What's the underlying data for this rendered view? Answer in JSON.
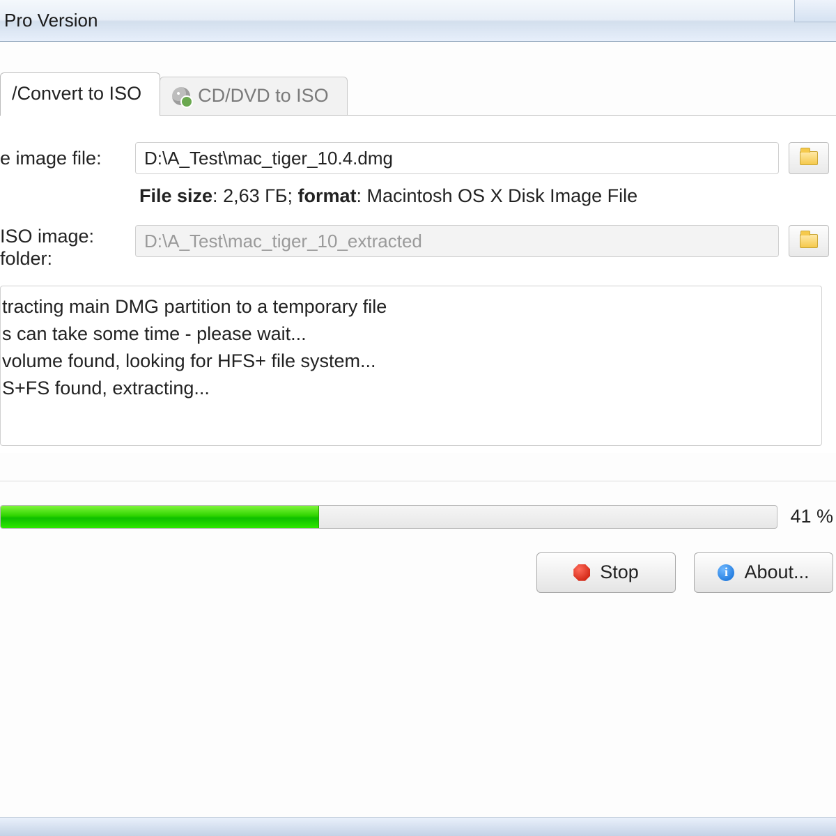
{
  "titlebar": {
    "title": "Pro Version"
  },
  "tabs": {
    "convert": {
      "label": "/Convert to ISO"
    },
    "cddvd": {
      "label": "CD/DVD to ISO"
    }
  },
  "source": {
    "label": "e image file:",
    "value": "D:\\A_Test\\mac_tiger_10.4.dmg",
    "browse": "O"
  },
  "info": {
    "filesize_label": "File size",
    "filesize_value": "2,63 ГБ",
    "format_label": "format",
    "format_value": "Macintosh OS X Disk Image File"
  },
  "dest": {
    "label_top": " ISO image:",
    "label_bottom": "folder:",
    "value": "D:\\A_Test\\mac_tiger_10_extracted",
    "browse": "S"
  },
  "log": {
    "l1": "tracting main DMG partition to a temporary file",
    "l2": "s can take some time - please wait...",
    "l3": " volume found, looking for HFS+ file system...",
    "l4": "S+FS found, extracting..."
  },
  "progress": {
    "percent_text": "41 %",
    "percent_value": 41
  },
  "buttons": {
    "stop": "Stop",
    "about": "About..."
  }
}
